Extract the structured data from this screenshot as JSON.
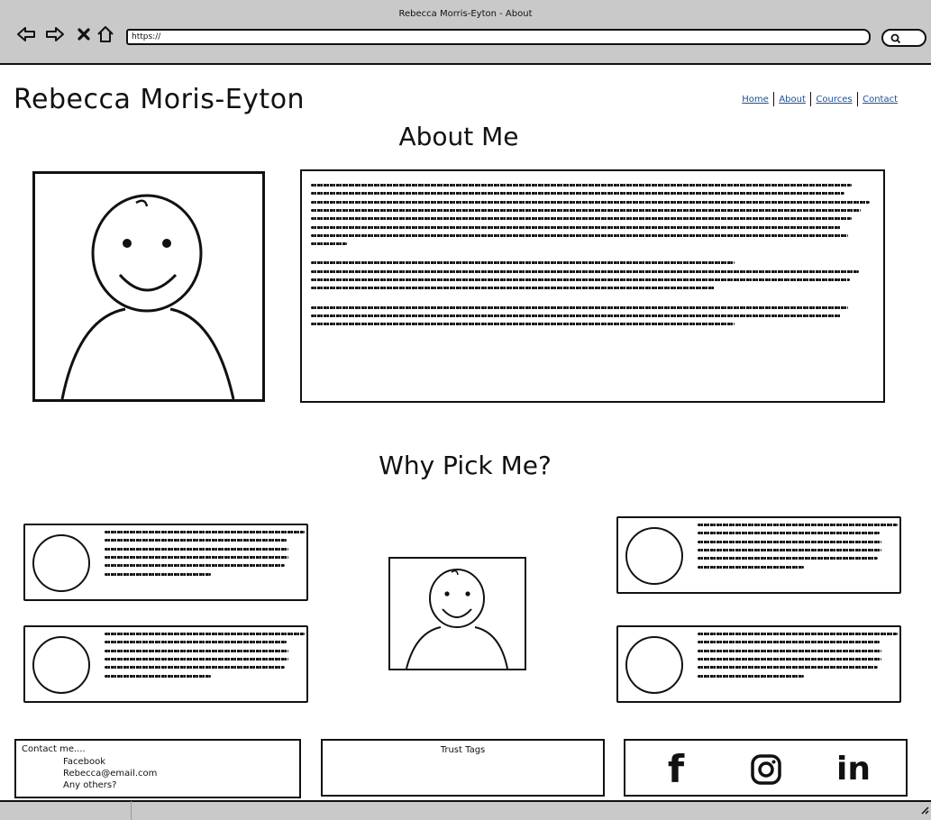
{
  "browser": {
    "window_title": "Rebecca Morris-Eyton - About",
    "url": "https://",
    "icons": [
      "back-icon",
      "forward-icon",
      "stop-icon",
      "home-icon",
      "search-icon",
      "resize-grip-icon"
    ]
  },
  "header": {
    "site_title": "Rebecca Moris-Eyton",
    "nav": [
      {
        "label": "Home"
      },
      {
        "label": "About"
      },
      {
        "label": "Cources"
      },
      {
        "label": "Contact"
      }
    ]
  },
  "about": {
    "heading": "About Me",
    "photo_icon": "person-avatar"
  },
  "why": {
    "heading": "Why Pick Me?"
  },
  "footer": {
    "contact_title": "Contact me....",
    "contact_items": [
      "Facebook",
      "Rebecca@email.com",
      "Any others?"
    ],
    "trust_label": "Trust Tags",
    "social": [
      {
        "icon": "facebook-icon",
        "glyph": "f"
      },
      {
        "icon": "instagram-icon"
      },
      {
        "icon": "linkedin-icon",
        "glyph": "in"
      }
    ]
  },
  "colors": {
    "chrome": "#c9c9c9",
    "link": "#1a4fa0",
    "ink": "#111111"
  }
}
